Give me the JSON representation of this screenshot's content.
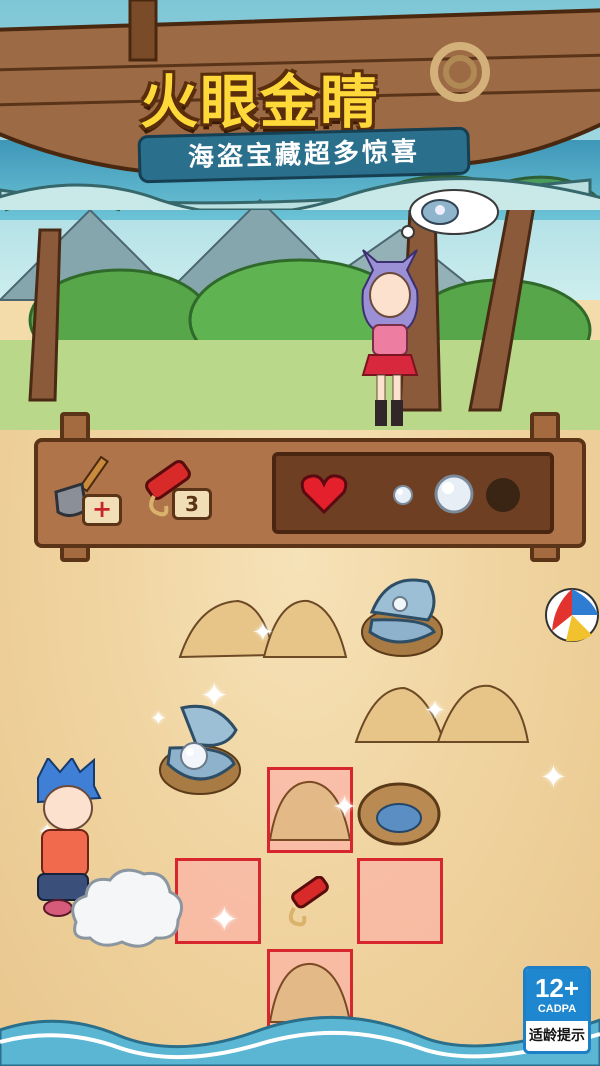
{
  "title": {
    "main": "火眼金睛",
    "sub": "海盗宝藏超多惊喜"
  },
  "toolbar": {
    "shovel_badge": "+",
    "dynamite_count": "3"
  },
  "inventory": {
    "items": [
      "heart-icon",
      "pearl-small-icon",
      "pearl-large-icon",
      "empty-slot"
    ]
  },
  "age_rating": {
    "number": "12+",
    "org": "CADPA",
    "label": "适龄提示"
  },
  "colors": {
    "title_yellow": "#ffd83a",
    "tile_red": "#d7262e",
    "wood": "#b0744a",
    "age_blue": "#1f87cf"
  }
}
